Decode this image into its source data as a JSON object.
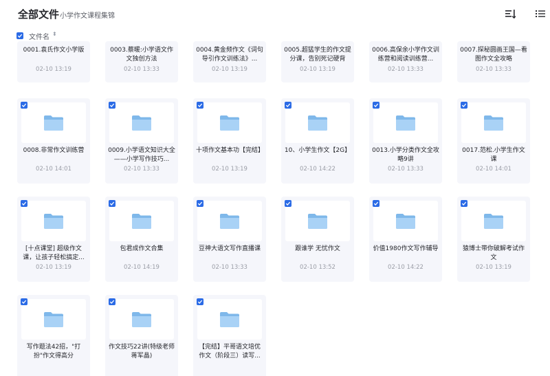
{
  "header": {
    "title": "全部文件",
    "breadcrumb_sep": "›",
    "breadcrumb": "小学作文课程集锦"
  },
  "toolbar": {
    "sort_icon": "sort-icon",
    "list_icon": "list-view-icon"
  },
  "column": {
    "name_label": "文件名",
    "sort_caret": "⬍"
  },
  "colors": {
    "accent": "#2b6be6",
    "card_bg": "#f5f6fb",
    "folder": "#7fb8ea",
    "folder_light": "#a9d2f6"
  },
  "files": [
    {
      "name": "0001.袁氏作文小学版",
      "date": "02-10 13:19"
    },
    {
      "name": "0003.蔡暖:小学语文作文独创方法",
      "date": "02-10 13:33"
    },
    {
      "name": "0004.黄金频作文《词句导引作文训练法》...",
      "date": "02-10 13:19"
    },
    {
      "name": "0005.超猛学生的作文提分课，告别死记硬背",
      "date": "02-10 13:19"
    },
    {
      "name": "0006.高保余小学作文训练营和阅读训练营...",
      "date": "02-10 13:33"
    },
    {
      "name": "0007.探秘圆画王国—看图作文全攻略",
      "date": "02-10 13:33"
    },
    {
      "name": "0008.非常作文训练营",
      "date": "02-10 14:01"
    },
    {
      "name": "0009.小学语文知识大全——小学写作技巧...",
      "date": "02-10 13:33"
    },
    {
      "name": "十项作文基本功【完结】",
      "date": "02-10 13:19"
    },
    {
      "name": "10、小学生作文【2G】",
      "date": "02-10 14:22"
    },
    {
      "name": "0013.小学分类作文全攻略9讲",
      "date": "02-10 13:33"
    },
    {
      "name": "0017.范松.小学生作文课",
      "date": "02-10 14:01"
    },
    {
      "name": "[十点课堂] 超级作文课，让孩子轻松搞定...",
      "date": "02-10 13:19"
    },
    {
      "name": "包君成作文合集",
      "date": "02-10 14:19"
    },
    {
      "name": "豆神大语文写作直播课",
      "date": "02-10 13:33"
    },
    {
      "name": "跟谁学 无忧作文",
      "date": "02-10 13:52"
    },
    {
      "name": "价值1980作文写作辅导",
      "date": "02-10 14:22"
    },
    {
      "name": "猿博士带你破解考试作文",
      "date": "02-10 13:19"
    },
    {
      "name": "写作题法42招，\"打扮\"作文得高分",
      "date": ""
    },
    {
      "name": "作文技巧22讲(特级老师蒋军晶)",
      "date": ""
    },
    {
      "name": "【完结】平哥语文培优作文（阶段三）读写...",
      "date": ""
    }
  ]
}
